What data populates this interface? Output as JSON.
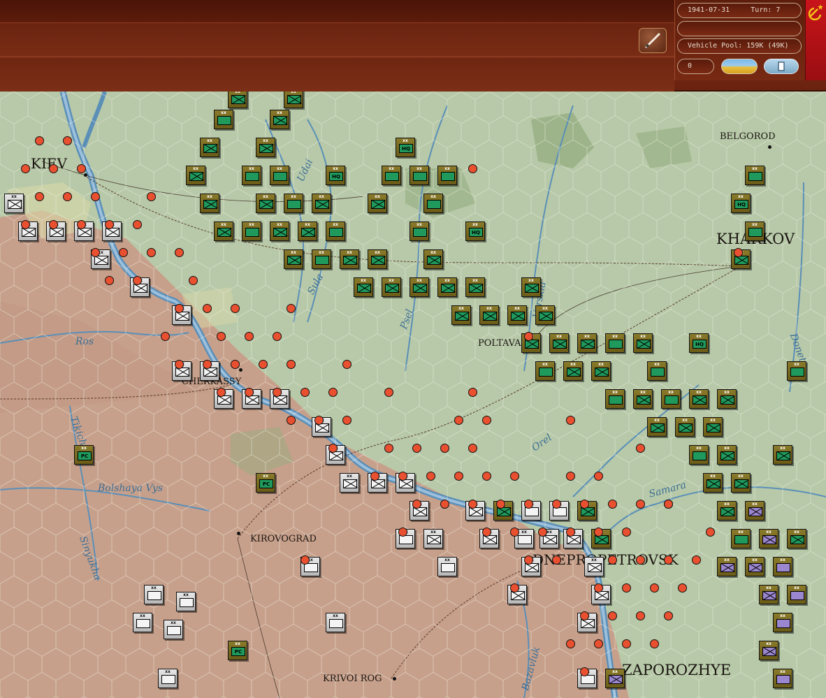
{
  "status": {
    "date": "1941-07-31",
    "turn": "Turn: 7",
    "message": "",
    "vehicle_pool": "Vehicle Pool: 159K (49K)",
    "counter": "0"
  },
  "icons": {
    "pen": "pen-icon",
    "flag": "hammer-sickle-icon",
    "weather": "clear-weather-icon",
    "toggle": "unit-toggle-icon"
  },
  "colors": {
    "topbar": "#7a2b14",
    "flag": "#c8141a",
    "soviet_unit": "#6a5c18",
    "axis_unit": "#b8b8b8",
    "terrain_clear": "#b9ccaa",
    "terrain_steppe": "#c9a08a",
    "river": "#5b8fb8"
  },
  "map": {
    "cities": [
      {
        "name": "KIEV"
      },
      {
        "name": "BELGOROD"
      },
      {
        "name": "KHARKOV"
      },
      {
        "name": "POLTAVA"
      },
      {
        "name": "CHERKASSY"
      },
      {
        "name": "KIROVOGRAD"
      },
      {
        "name": "DNEPROPETROVSK"
      },
      {
        "name": "KRIVOI ROG"
      },
      {
        "name": "ZAPOROZHYE"
      }
    ],
    "rivers": [
      {
        "name": "Ros"
      },
      {
        "name": "Sula"
      },
      {
        "name": "Udai"
      },
      {
        "name": "Psel"
      },
      {
        "name": "Vorskla"
      },
      {
        "name": "Orel"
      },
      {
        "name": "Samara"
      },
      {
        "name": "Tikich"
      },
      {
        "name": "Bolshaya Vys"
      },
      {
        "name": "Sinyukha"
      },
      {
        "name": "Bazavluk"
      },
      {
        "name": "Donets"
      }
    ],
    "unit_labels": {
      "sov_div": "xx",
      "sov_army": "xxxx",
      "hq": "HQ",
      "pc": "PC"
    }
  }
}
